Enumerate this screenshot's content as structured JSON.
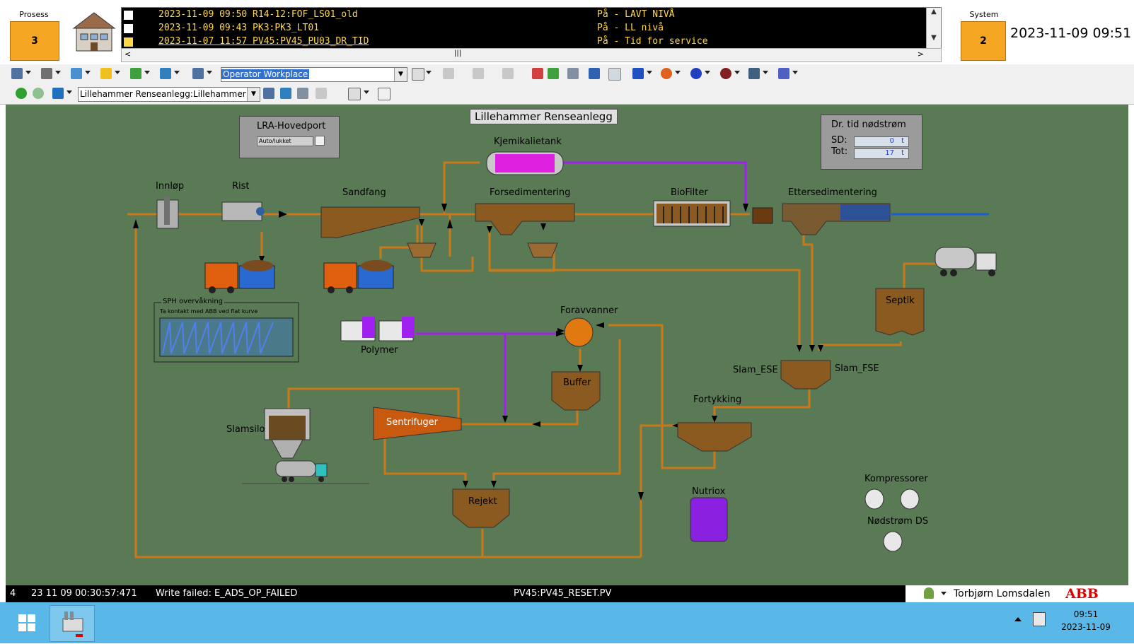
{
  "header": {
    "process_label": "Prosess",
    "process_count": "3",
    "system_label": "System",
    "system_count": "2",
    "datetime": "2023-11-09 09:51"
  },
  "alarms": [
    {
      "time": "2023-11-09 09:50 R14-12:FOF_LS01_old",
      "state": "På - LAVT NIVÅ"
    },
    {
      "time": "2023-11-09 09:43 PK3:PK3_LT01",
      "state": "På - LL nivå"
    },
    {
      "time": "2023-11-07 11:57 PV45:PV45_PU03_DR_TID",
      "state": "På - Tid for service"
    }
  ],
  "toolbar": {
    "workplace_combo": "Operator Workplace",
    "path_combo": "Lillehammer Renseanlegg:Lillehammer Ren"
  },
  "process": {
    "title": "Lillehammer Renseanlegg",
    "gate_panel": {
      "title": "LRA-Hovedport",
      "status": "Auto/lukket"
    },
    "backup_panel": {
      "title": "Dr. tid nødstrøm",
      "sd_label": "SD:",
      "sd_value": "0",
      "tot_label": "Tot:",
      "tot_value": "17",
      "unit": "t"
    },
    "labels": {
      "innlop": "Innløp",
      "rist": "Rist",
      "sandfang": "Sandfang",
      "kjemikalietank": "Kjemikalietank",
      "forsedimentering": "Forsedimentering",
      "biofilter": "BioFilter",
      "ettersedimentering": "Ettersedimentering",
      "foravvanner": "Foravvanner",
      "polymer": "Polymer",
      "buffer": "Buffer",
      "septik": "Septik",
      "slam_ese": "Slam_ESE",
      "slam_fse": "Slam_FSE",
      "fortykking": "Fortykking",
      "sentrifuger": "Sentrifuger",
      "slamsilo": "Slamsilo",
      "rejekt": "Rejekt",
      "nutriox": "Nutriox",
      "kompressorer": "Kompressorer",
      "nodstrom_ds": "Nødstrøm DS"
    },
    "sph": {
      "title": "SPH overvåkning",
      "subtitle": "Ta kontakt med ABB ved flat kurve"
    }
  },
  "statusbar": {
    "index": "4",
    "timestamp": "23 11 09 00:30:57:471",
    "message": "Write failed: E_ADS_OP_FAILED",
    "tag": "PV45:PV45_RESET.PV",
    "user": "Torbjørn Lomsdalen",
    "brand": "ABB"
  },
  "taskbar": {
    "time": "09:51",
    "date": "2023-11-09"
  },
  "colors": {
    "alarm_text": "#ffd84a",
    "orange": "#f5a623",
    "process_bg": "#5a7a55",
    "pipe": "#c87a1a",
    "purple": "#a020f0",
    "sludge": "#7a4a10",
    "water": "#1a5fd0"
  }
}
